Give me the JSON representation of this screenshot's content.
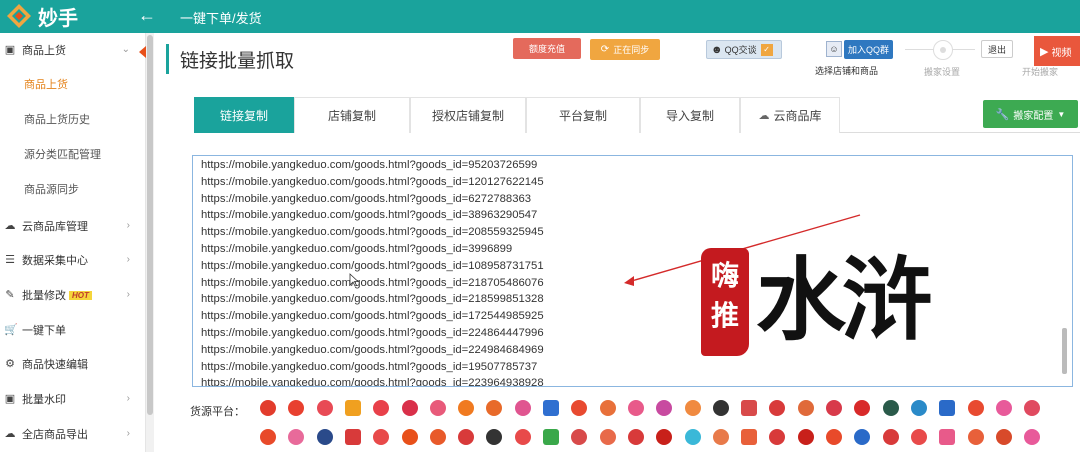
{
  "app": {
    "name": "妙手",
    "header_title": "一键下单/发货"
  },
  "colors": {
    "primary": "#1aa39c",
    "accent_orange": "#e4821a",
    "danger": "#e46a5c",
    "success": "#3daa52",
    "watermark_red": "#c41a1f"
  },
  "sidebar": {
    "items": [
      {
        "label": "商品上货",
        "icon": "box-icon",
        "expanded": true
      },
      {
        "label": "云商品库管理",
        "icon": "cloud-icon"
      },
      {
        "label": "数据采集中心",
        "icon": "database-icon"
      },
      {
        "label": "批量修改",
        "icon": "edit-icon",
        "badge": "HOT"
      },
      {
        "label": "一键下单",
        "icon": "cart-icon"
      },
      {
        "label": "商品快速编辑",
        "icon": "gear-icon"
      },
      {
        "label": "批量水印",
        "icon": "image-icon"
      },
      {
        "label": "全店商品导出",
        "icon": "cloud-download-icon"
      }
    ],
    "subitems": [
      {
        "label": "商品上货",
        "active": true
      },
      {
        "label": "商品上货历史"
      },
      {
        "label": "源分类匹配管理"
      },
      {
        "label": "商品源同步"
      }
    ]
  },
  "page": {
    "title": "链接批量抓取",
    "buttons": {
      "recharge": "额度充值",
      "syncing": "正在同步",
      "qq_chat": "QQ交谈",
      "join_qq_group": "加入QQ群",
      "exit": "退出",
      "video": "视频"
    },
    "steps": [
      "选择店铺和商品",
      "搬家设置",
      "开始搬家"
    ]
  },
  "tabs": [
    {
      "label": "链接复制",
      "active": true
    },
    {
      "label": "店铺复制"
    },
    {
      "label": "授权店铺复制"
    },
    {
      "label": "平台复制"
    },
    {
      "label": "导入复制"
    },
    {
      "label": "云商品库",
      "icon": "cloud-icon"
    }
  ],
  "config_button": "搬家配置",
  "urls": [
    "https://mobile.yangkeduo.com/goods.html?goods_id=95203726599",
    "https://mobile.yangkeduo.com/goods.html?goods_id=120127622145",
    "https://mobile.yangkeduo.com/goods.html?goods_id=6272788363",
    "https://mobile.yangkeduo.com/goods.html?goods_id=38963290547",
    "https://mobile.yangkeduo.com/goods.html?goods_id=208559325945",
    "https://mobile.yangkeduo.com/goods.html?goods_id=3996899",
    "https://mobile.yangkeduo.com/goods.html?goods_id=108958731751",
    "https://mobile.yangkeduo.com/goods.html?goods_id=218705486076",
    "https://mobile.yangkeduo.com/goods.html?goods_id=218599851328",
    "https://mobile.yangkeduo.com/goods.html?goods_id=172544985925",
    "https://mobile.yangkeduo.com/goods.html?goods_id=224864447996",
    "https://mobile.yangkeduo.com/goods.html?goods_id=224984684969",
    "https://mobile.yangkeduo.com/goods.html?goods_id=19507785737",
    "https://mobile.yangkeduo.com/goods.html?goods_id=223964938928"
  ],
  "watermark": {
    "seal": "嗨推",
    "text": "水浒"
  },
  "source_platform": {
    "label": "货源平台：",
    "row1_colors": [
      "#e23c2c",
      "#e8402f",
      "#e84a55",
      "#f0a020",
      "#e8404a",
      "#d9304a",
      "#e85a7a",
      "#f07a20",
      "#e86a2a",
      "#e05590",
      "#2f6fd0",
      "#e84a30",
      "#e8703a",
      "#e85a8a",
      "#c84aa0",
      "#f08a40",
      "#333333",
      "#d84a4a",
      "#d83a3a",
      "#e06a3a",
      "#d83a4a",
      "#d82a2a",
      "#2a5a4a",
      "#2a8ac8",
      "#2a6ac8",
      "#e84a30",
      "#e85a9a",
      "#e04a60"
    ],
    "row2_colors": [
      "#e84a2a",
      "#e86a9a",
      "#2a4a8a",
      "#d83a3a",
      "#e84a4a",
      "#e8501a",
      "#e85a2a",
      "#d83a3a",
      "#333333",
      "#e84a4a",
      "#3aa84a",
      "#d84a4a",
      "#e86a4a",
      "#d83a3a",
      "#c8201a",
      "#3ab8d8",
      "#e87a4a",
      "#e8603a",
      "#d83a3a",
      "#c8201a",
      "#e84a2a",
      "#2a6ac8",
      "#d83a3a",
      "#e84a4a",
      "#e85a8a",
      "#e8603a",
      "#d84a2a",
      "#e85a9a"
    ]
  }
}
